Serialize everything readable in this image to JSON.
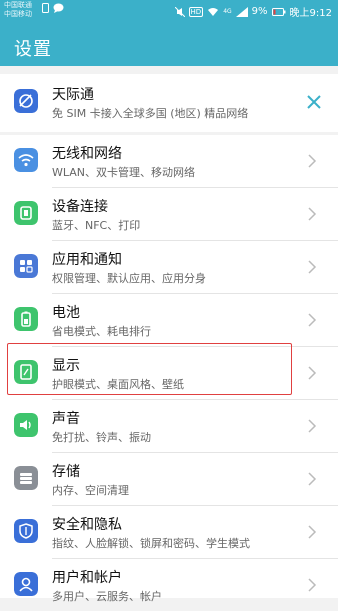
{
  "status_bar": {
    "carrier_1": "中国联通",
    "carrier_2": "中国移动",
    "net": "HD",
    "signal_tag": "4G",
    "battery": "9%",
    "time": "晚上9:12"
  },
  "header": {
    "title": "设置"
  },
  "promo": {
    "title": "天际通",
    "subtitle": "免 SIM 卡接入全球多国 (地区) 精品网络"
  },
  "items": [
    {
      "title": "无线和网络",
      "subtitle": "WLAN、双卡管理、移动网络",
      "icon": "wifi-icon",
      "color": "#4a90e2"
    },
    {
      "title": "设备连接",
      "subtitle": "蓝牙、NFC、打印",
      "icon": "device-connect-icon",
      "color": "#3ec46d"
    },
    {
      "title": "应用和通知",
      "subtitle": "权限管理、默认应用、应用分身",
      "icon": "apps-grid-icon",
      "color": "#4a78d6"
    },
    {
      "title": "电池",
      "subtitle": "省电模式、耗电排行",
      "icon": "battery-icon",
      "color": "#3ec46d"
    },
    {
      "title": "显示",
      "subtitle": "护眼模式、桌面风格、壁纸",
      "icon": "display-icon",
      "color": "#3ec46d"
    },
    {
      "title": "声音",
      "subtitle": "免打扰、铃声、振动",
      "icon": "speaker-icon",
      "color": "#3ec46d"
    },
    {
      "title": "存储",
      "subtitle": "内存、空间清理",
      "icon": "storage-icon",
      "color": "#8a8f96"
    },
    {
      "title": "安全和隐私",
      "subtitle": "指纹、人脸解锁、锁屏和密码、学生模式",
      "icon": "shield-icon",
      "color": "#3a6fd8"
    },
    {
      "title": "用户和帐户",
      "subtitle": "多用户、云服务、帐户",
      "icon": "user-icon",
      "color": "#3a6fd8"
    }
  ],
  "colors": {
    "header": "#3bb0c9",
    "highlight": "#e04040"
  }
}
